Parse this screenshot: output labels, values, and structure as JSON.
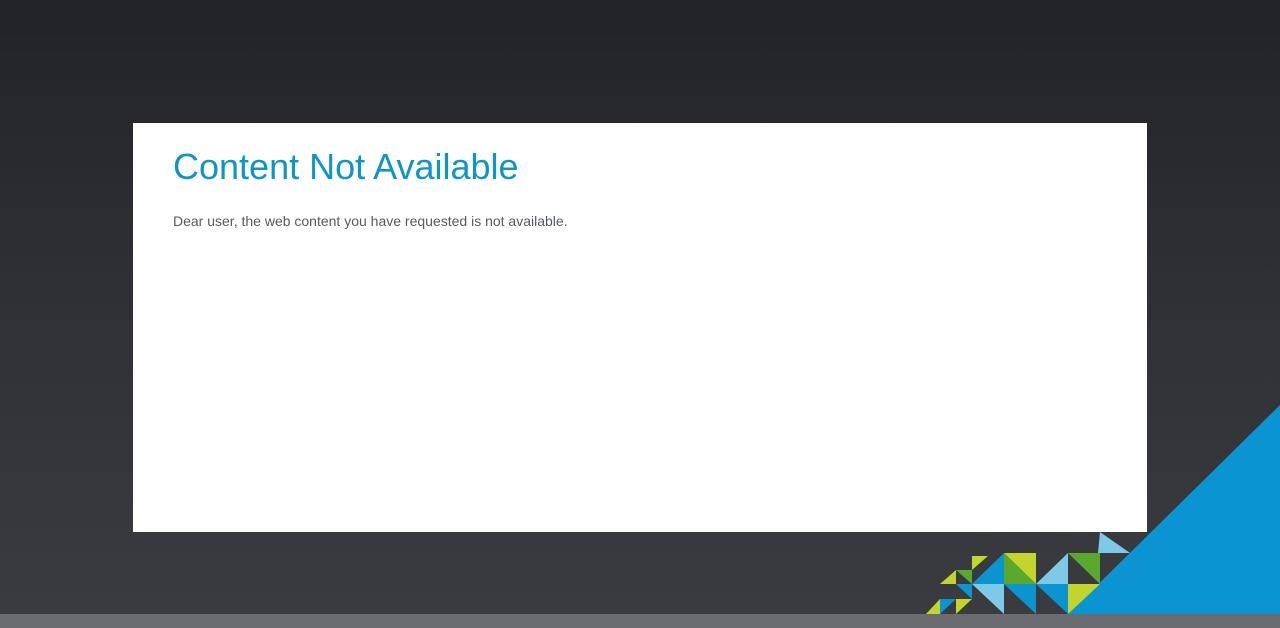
{
  "page": {
    "title": "Content Not Available",
    "message": "Dear user, the web content you have requested is not available."
  },
  "theme": {
    "background_dark": "#222326",
    "background_light": "#3b3c40",
    "panel": "#ffffff",
    "title_color": "#0e95c8",
    "text_color": "#555a5f",
    "accent_blue": "#0a94d2",
    "accent_light_blue": "#7ec8e8",
    "accent_green": "#5aa82e",
    "accent_lime": "#c2d52b"
  }
}
